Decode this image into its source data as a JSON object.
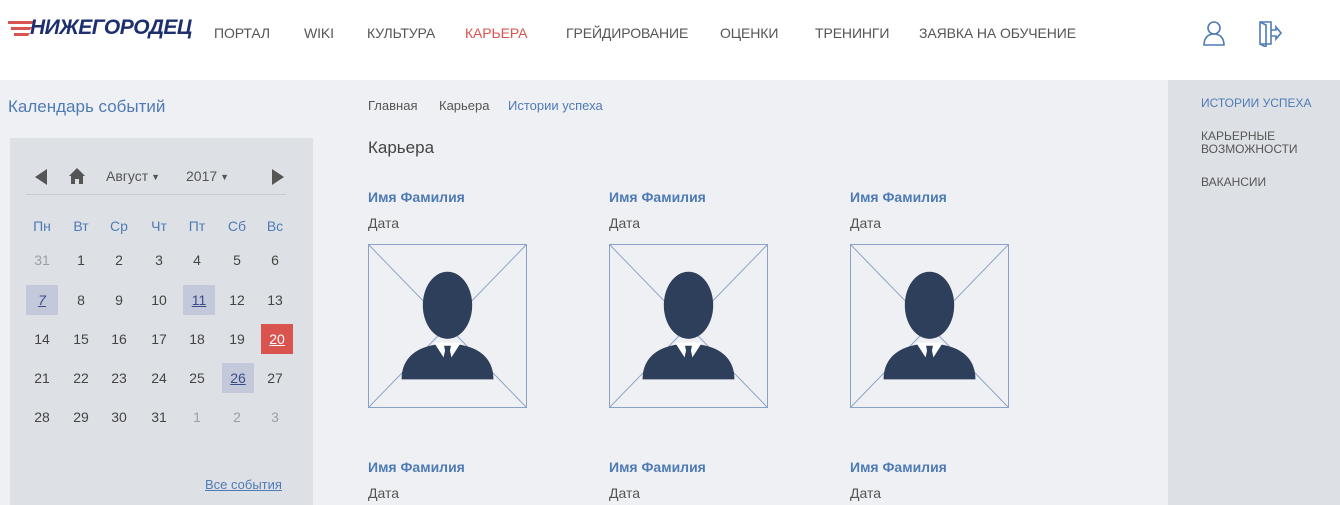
{
  "header": {
    "logo_text": "НИЖЕГОРОДЕЦ",
    "nav": [
      {
        "label": "ПОРТАЛ",
        "active": false
      },
      {
        "label": "WIKI",
        "active": false
      },
      {
        "label": "КУЛЬТУРА",
        "active": false
      },
      {
        "label": "КАРЬЕРА",
        "active": true
      },
      {
        "label": "ГРЕЙДИРОВАНИЕ",
        "active": false
      },
      {
        "label": "ОЦЕНКИ",
        "active": false
      },
      {
        "label": "ТРЕНИНГИ",
        "active": false
      },
      {
        "label": "ЗАЯВКА НА ОБУЧЕНИЕ",
        "active": false
      }
    ],
    "icons": [
      "user-icon",
      "logout-icon"
    ]
  },
  "calendar": {
    "title": "Календарь событий",
    "month": "Август",
    "year": "2017",
    "weekdays": [
      "Пн",
      "Вт",
      "Ср",
      "Чт",
      "Пт",
      "Сб",
      "Вс"
    ],
    "weeks": [
      [
        "31",
        "1",
        "2",
        "3",
        "4",
        "5",
        "6"
      ],
      [
        "7",
        "8",
        "9",
        "10",
        "11",
        "12",
        "13"
      ],
      [
        "14",
        "15",
        "16",
        "17",
        "18",
        "19",
        "20"
      ],
      [
        "21",
        "22",
        "23",
        "24",
        "25",
        "26",
        "27"
      ],
      [
        "28",
        "29",
        "30",
        "31",
        "1",
        "2",
        "3"
      ]
    ],
    "all_events": "Все события"
  },
  "breadcrumb": [
    "Главная",
    "Карьера",
    "Истории успеха"
  ],
  "page_title": "Карьера",
  "people": [
    {
      "name": "Имя Фамилия",
      "date": "Дата"
    },
    {
      "name": "Имя Фамилия",
      "date": "Дата"
    },
    {
      "name": "Имя Фамилия",
      "date": "Дата"
    },
    {
      "name": "Имя Фамилия",
      "date": "Дата"
    },
    {
      "name": "Имя Фамилия",
      "date": "Дата"
    },
    {
      "name": "Имя Фамилия",
      "date": "Дата"
    }
  ],
  "right_menu": [
    {
      "label": "ИСТОРИИ УСПЕХА",
      "active": true
    },
    {
      "label": "КАРЬЕРНЫЕ ВОЗМОЖНОСТИ",
      "active": false
    },
    {
      "label": "ВАКАНСИИ",
      "active": false
    }
  ],
  "colors": {
    "accent": "#4f7bb5",
    "active_nav": "#d9534f",
    "brand": "#1d2f6f",
    "avatar": "#2d3f5a"
  }
}
